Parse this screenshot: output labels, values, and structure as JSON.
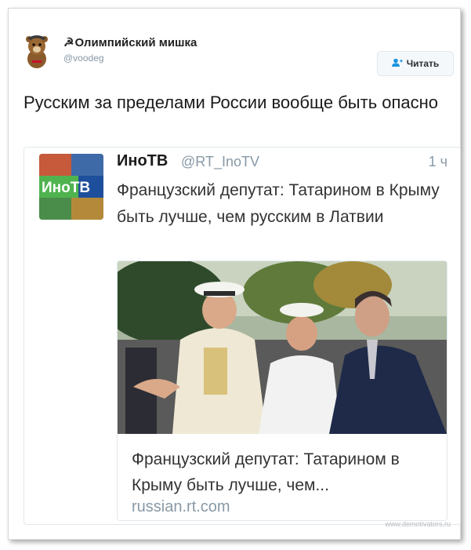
{
  "author": {
    "symbol": "☭",
    "name": "Олимпийский мишка",
    "handle": "@voodeg"
  },
  "follow_button": {
    "label": "Читать",
    "icon": "add-user-icon"
  },
  "tweet": {
    "text": "Русским за пределами России вообще быть опасно"
  },
  "quoted": {
    "name": "ИноТВ",
    "handle": "@RT_InoTV",
    "time": "1 ч",
    "text": "Французский депутат: Татарином в Крыму быть лучше, чем русским в Латвии",
    "avatar_text": "ИноТВ",
    "card": {
      "title": "Французский депутат: Татарином в Крыму быть лучше, чем...",
      "domain": "russian.rt.com"
    }
  },
  "watermark": "www.demotivators.ru",
  "colors": {
    "accent": "#1b95e0",
    "muted": "#8899a6",
    "border": "#e1e8ed",
    "text": "#1a1a1a"
  }
}
